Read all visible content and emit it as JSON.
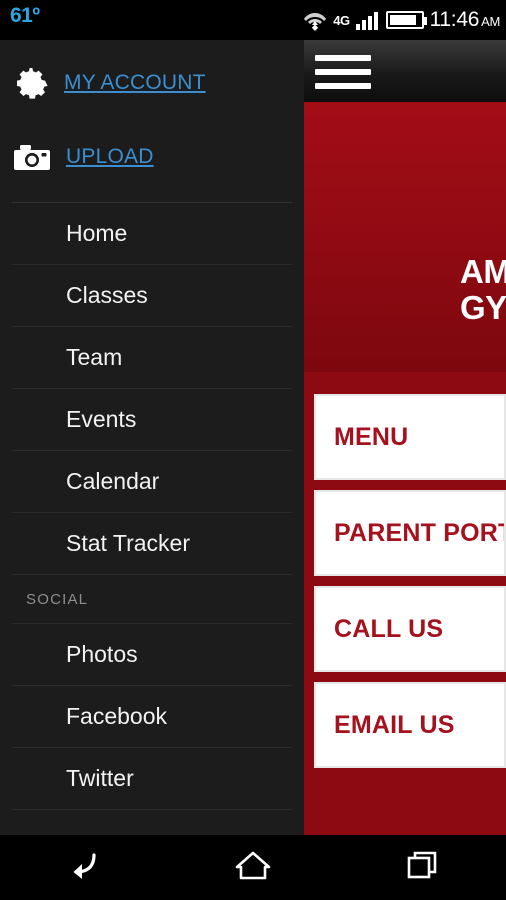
{
  "status_bar": {
    "temperature": "61º",
    "network_type": "4G",
    "clock_time": "11:46",
    "clock_ampm": "AM",
    "icons": [
      "wifi-icon",
      "signal-icon",
      "battery-icon"
    ],
    "temp_color": "#2aa7e0"
  },
  "drawer": {
    "account": {
      "label": "MY ACCOUNT",
      "icon": "gear-icon"
    },
    "upload": {
      "label": "UPLOAD",
      "icon": "camera-icon"
    },
    "nav_items": [
      {
        "label": "Home"
      },
      {
        "label": "Classes"
      },
      {
        "label": "Team"
      },
      {
        "label": "Events"
      },
      {
        "label": "Calendar"
      },
      {
        "label": "Stat Tracker"
      }
    ],
    "social_section_label": "SOCIAL",
    "social_items": [
      {
        "label": "Photos"
      },
      {
        "label": "Facebook"
      },
      {
        "label": "Twitter"
      }
    ],
    "link_color": "#3b8fd1"
  },
  "content": {
    "menu_icon": "hamburger-icon",
    "hero": {
      "logo_line1": "AM",
      "logo_line2": "GYM"
    },
    "buttons": [
      {
        "label": "MENU"
      },
      {
        "label": "PARENT PORT"
      },
      {
        "label": "CALL US"
      },
      {
        "label": "EMAIL US"
      }
    ],
    "brand_red": "#8d0a12",
    "button_text_color": "#a5111c"
  },
  "nav_bar": {
    "buttons": [
      {
        "name": "back-button",
        "icon": "back-arrow-icon"
      },
      {
        "name": "home-button",
        "icon": "home-icon"
      },
      {
        "name": "recents-button",
        "icon": "recents-icon"
      }
    ]
  }
}
